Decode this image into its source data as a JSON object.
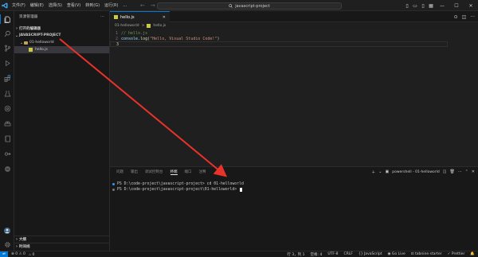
{
  "titlebar": {
    "menu": [
      "文件(F)",
      "编辑(E)",
      "选择(S)",
      "查看(V)",
      "转到(G)",
      "运行(R)",
      "..."
    ],
    "search_text": "javascript-project"
  },
  "sidebar": {
    "header": "资源管理器",
    "open_editors": "打开的编辑器",
    "project": "JAVASCRIPT-PROJECT",
    "folder": "01-helloworld",
    "file": "hello.js",
    "outline": "大纲",
    "timeline": "时间线"
  },
  "editor": {
    "tab_label": "hello.js",
    "breadcrumb": [
      "01-helloworld",
      ">",
      "hello.js"
    ],
    "lines": [
      {
        "num": "1",
        "comment": "// hello.js"
      },
      {
        "num": "2",
        "obj": "console",
        "dot": ".",
        "fn": "log",
        "open": "(",
        "str": "\"Hello, Visual Studio Code!\"",
        "close": ")"
      },
      {
        "num": "3"
      }
    ]
  },
  "panel": {
    "tabs": [
      "问题",
      "输出",
      "调试控制台",
      "终端",
      "端口",
      "注释"
    ],
    "active_tab": "终端",
    "terminal_name": "powershell - 01-helloworld",
    "lines": [
      "PS D:\\code-project\\javascript-project> cd 01-helloworld",
      "PS D:\\code-project\\javascript-project\\01-helloworld> "
    ]
  },
  "statusbar": {
    "errors": "0",
    "warnings": "0",
    "info": "0",
    "cursor_pos": "行 3，列 1",
    "spaces": "空格: 4",
    "encoding": "UTF-8",
    "eol": "CRLF",
    "language": "{} JavaScript",
    "golive": "Go Live",
    "tabnine": "tabnine starter",
    "prettier": "Prettier"
  },
  "colors": {
    "accent": "#0078d4",
    "arrow": "#e8322a"
  }
}
